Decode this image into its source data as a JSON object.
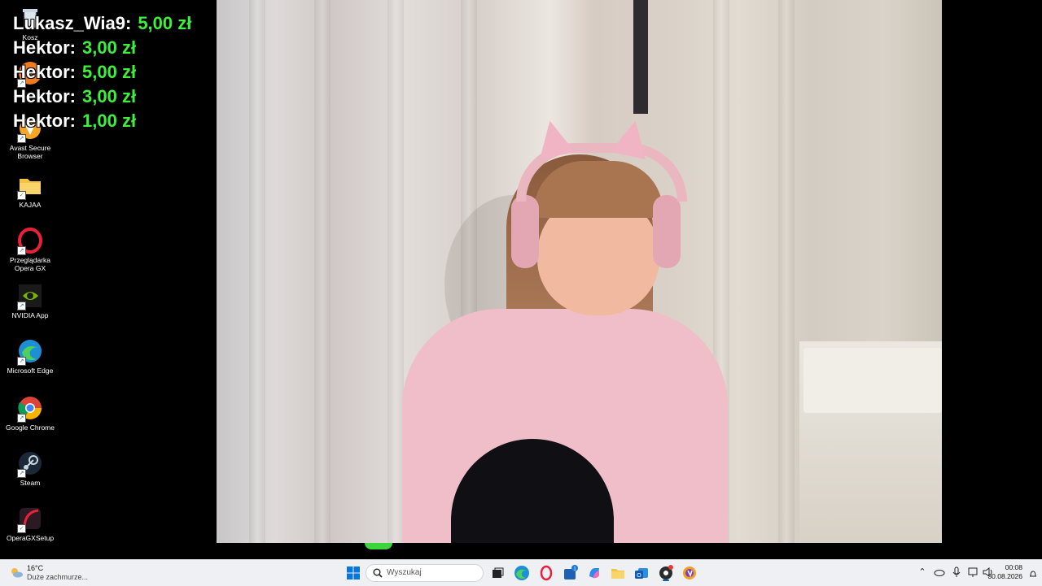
{
  "desktop_icons": [
    {
      "name": "recycle-bin-icon",
      "label": "Kosz"
    },
    {
      "name": "app-icon-orange",
      "label": ""
    },
    {
      "name": "avast-browser-icon",
      "label": "Avast Secure Browser"
    },
    {
      "name": "folder-icon",
      "label": "KAJAA"
    },
    {
      "name": "opera-gx-icon",
      "label": "Przeglądarka Opera GX"
    },
    {
      "name": "nvidia-icon",
      "label": "NVIDIA App"
    },
    {
      "name": "edge-icon",
      "label": "Microsoft Edge"
    },
    {
      "name": "chrome-icon",
      "label": "Google Chrome"
    },
    {
      "name": "steam-icon",
      "label": "Steam"
    },
    {
      "name": "opera-gx-setup-icon",
      "label": "OperaGXSetup"
    }
  ],
  "donations": [
    {
      "name": "Lukasz_Wia9:",
      "amount": "5,00 zł"
    },
    {
      "name": "Hektor:",
      "amount": "3,00 zł"
    },
    {
      "name": "Hektor:",
      "amount": "5,00 zł"
    },
    {
      "name": "Hektor:",
      "amount": "3,00 zł"
    },
    {
      "name": "Hektor:",
      "amount": "1,00 zł"
    }
  ],
  "taskbar": {
    "weather_temp": "16°C",
    "weather_desc": "Duże zachmurze...",
    "search_placeholder": "Wyszukaj",
    "time": "00:08",
    "date": "30.08.2026",
    "colors": {
      "accent": "#0067c0",
      "donation_amount": "#3cf03c"
    }
  }
}
